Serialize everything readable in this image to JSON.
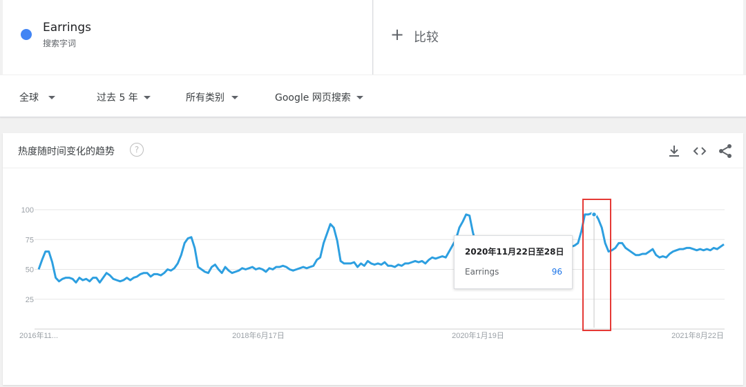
{
  "search_term": {
    "name": "Earrings",
    "type_label": "搜索字词",
    "dot_color": "#4285f4"
  },
  "compare": {
    "plus": "+",
    "label": "比较"
  },
  "filters": [
    {
      "label": "全球"
    },
    {
      "label": "过去 5 年"
    },
    {
      "label": "所有类别"
    },
    {
      "label": "Google 网页搜索"
    }
  ],
  "card": {
    "title": "热度随时间变化的趋势",
    "help_icon": "?",
    "icons": [
      "download-icon",
      "embed-icon",
      "share-icon"
    ]
  },
  "tooltip": {
    "date": "2020年11月22日至28日",
    "term": "Earrings",
    "value": "96"
  },
  "chart_data": {
    "type": "line",
    "title": "",
    "xlabel": "",
    "ylabel": "",
    "ylim": [
      0,
      100
    ],
    "y_ticks": [
      "25",
      "50",
      "75",
      "100"
    ],
    "x_tick_labels": [
      "2016年11...",
      "2018年6月17日",
      "2020年1月19日",
      "2021年8月22日"
    ],
    "x_range": [
      "2016-11",
      "2021-09"
    ],
    "grid": true,
    "series": [
      {
        "name": "",
        "color": "#2d9fe0",
        "values": [
          50,
          58,
          65,
          65,
          56,
          43,
          40,
          42,
          43,
          43,
          42,
          39,
          43,
          41,
          42,
          40,
          43,
          43,
          39,
          43,
          47,
          45,
          42,
          41,
          40,
          41,
          43,
          41,
          43,
          44,
          46,
          47,
          47,
          44,
          46,
          46,
          45,
          47,
          50,
          49,
          51,
          55,
          62,
          72,
          76,
          77,
          68,
          52,
          50,
          48,
          47,
          52,
          54,
          50,
          47,
          52,
          49,
          47,
          48,
          49,
          51,
          50,
          51,
          52,
          50,
          51,
          50,
          48,
          51,
          50,
          52,
          52,
          53,
          52,
          50,
          49,
          50,
          51,
          52,
          51,
          52,
          53,
          58,
          60,
          72,
          80,
          88,
          85,
          74,
          57,
          55,
          55,
          55,
          56,
          52,
          55,
          53,
          57,
          55,
          54,
          55,
          54,
          56,
          53,
          53,
          52,
          54,
          53,
          55,
          55,
          56,
          57,
          56,
          57,
          55,
          58,
          60,
          59,
          60,
          61,
          60,
          65,
          70,
          75,
          85,
          90,
          96,
          95,
          81,
          70,
          68,
          66,
          63,
          60,
          50,
          45,
          42,
          40,
          38,
          38,
          42,
          45,
          48,
          50,
          55,
          58,
          60,
          62,
          64,
          65,
          66,
          66,
          66,
          67,
          67,
          68,
          68,
          69,
          70,
          72,
          82,
          96,
          96,
          97,
          97,
          92,
          85,
          72,
          65,
          66,
          68,
          72,
          72,
          68,
          66,
          64,
          62,
          62,
          63,
          63,
          65,
          67,
          62,
          60,
          61,
          60,
          63,
          65,
          66,
          67,
          67,
          68,
          68,
          67,
          66,
          67,
          66,
          67,
          66,
          68,
          67,
          69,
          71
        ]
      }
    ]
  }
}
